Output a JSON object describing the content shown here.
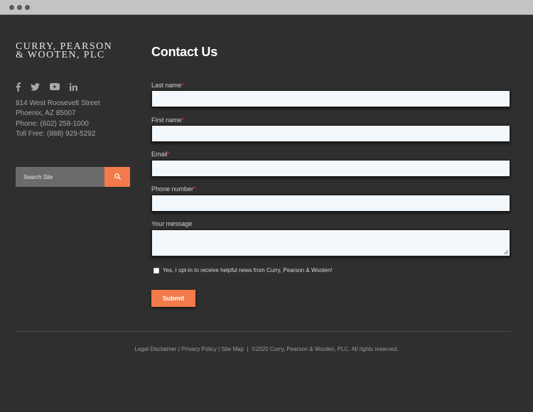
{
  "window": {
    "controls": [
      "dot",
      "dot",
      "dot"
    ]
  },
  "logo": {
    "line1": "Curry, Pearson",
    "line2": "& Wooten, PLC"
  },
  "social": {
    "icons": [
      "facebook-icon",
      "twitter-icon",
      "youtube-icon",
      "linkedin-icon"
    ],
    "color": "#a8a8a8"
  },
  "address": {
    "street": "814 West Roosevelt Street",
    "city": "Phoenix, AZ 85007",
    "phone": "Phone: (602) 258-1000",
    "toll_free": "Toll Free: (888) 929-5292"
  },
  "search": {
    "placeholder": "Search Site",
    "button_icon": "search-icon"
  },
  "form": {
    "title": "Contact Us",
    "required_marker": "*",
    "fields": {
      "last_name": {
        "label": "Last name",
        "value": ""
      },
      "first_name": {
        "label": "First name",
        "value": ""
      },
      "email": {
        "label": "Email",
        "value": ""
      },
      "phone": {
        "label": "Phone number",
        "value": ""
      },
      "message": {
        "label": "Your message",
        "value": ""
      }
    },
    "optin_text": "Yes, I opt-in to receive helpful news from Curry, Pearson & Wooten!",
    "optin_checked": false,
    "submit_label": "Submit"
  },
  "footer": {
    "links": [
      "Legal Disclaimer",
      "Privacy Policy",
      "Site Map"
    ],
    "link_separator": "|",
    "copyright_separator": "|",
    "copyright": "©2020 Curry, Pearson & Wooten, PLC. All rights reserved."
  },
  "colors": {
    "background": "#2f2f2f",
    "accent": "#f37a4a",
    "required": "#d63434",
    "field_background": "#f3f8fd"
  }
}
